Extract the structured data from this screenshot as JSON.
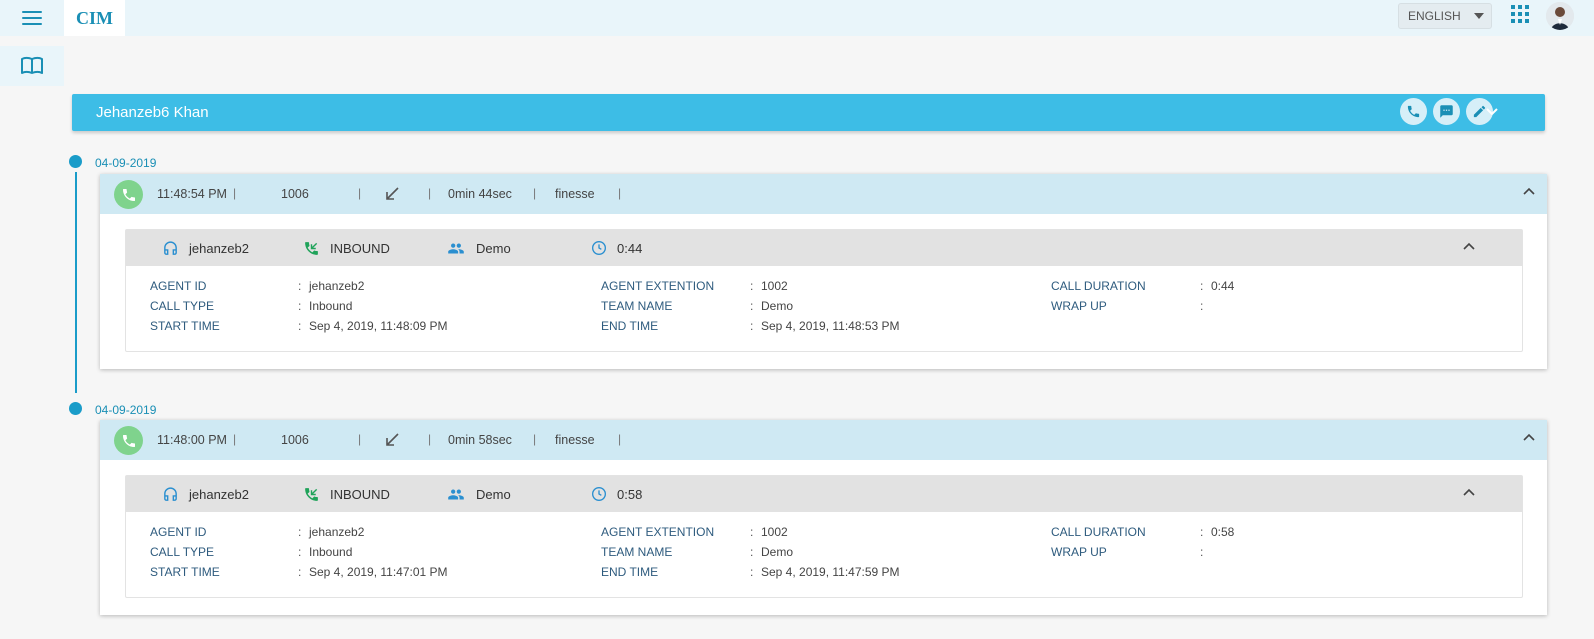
{
  "app": {
    "logo": "CIM"
  },
  "header": {
    "language": "ENGLISH"
  },
  "customer": {
    "name": "Jehanzeb6 Khan"
  },
  "calls": [
    {
      "date": "04-09-2019",
      "time": "11:48:54 PM",
      "number": "1006",
      "duration": "0min 44sec",
      "channel": "finesse",
      "agent": "jehanzeb2",
      "direction": "INBOUND",
      "team": "Demo",
      "timer": "0:44",
      "fields": {
        "agent_id_label": "AGENT ID",
        "agent_id": "jehanzeb2",
        "call_type_label": "CALL TYPE",
        "call_type": "Inbound",
        "start_time_label": "START TIME",
        "start_time": "Sep 4, 2019, 11:48:09 PM",
        "agent_ext_label": "AGENT EXTENTION",
        "agent_ext": "1002",
        "team_name_label": "TEAM NAME",
        "team_name": "Demo",
        "end_time_label": "END TIME",
        "end_time": "Sep 4, 2019, 11:48:53 PM",
        "call_duration_label": "CALL DURATION",
        "call_duration": "0:44",
        "wrap_up_label": "WRAP UP",
        "wrap_up": ""
      }
    },
    {
      "date": "04-09-2019",
      "time": "11:48:00 PM",
      "number": "1006",
      "duration": "0min 58sec",
      "channel": "finesse",
      "agent": "jehanzeb2",
      "direction": "INBOUND",
      "team": "Demo",
      "timer": "0:58",
      "fields": {
        "agent_id_label": "AGENT ID",
        "agent_id": "jehanzeb2",
        "call_type_label": "CALL TYPE",
        "call_type": "Inbound",
        "start_time_label": "START TIME",
        "start_time": "Sep 4, 2019, 11:47:01 PM",
        "agent_ext_label": "AGENT EXTENTION",
        "agent_ext": "1002",
        "team_name_label": "TEAM NAME",
        "team_name": "Demo",
        "end_time_label": "END TIME",
        "end_time": "Sep 4, 2019, 11:47:59 PM",
        "call_duration_label": "CALL DURATION",
        "call_duration": "0:58",
        "wrap_up_label": "WRAP UP",
        "wrap_up": ""
      }
    }
  ],
  "icons": {
    "menu": "hamburger-icon",
    "book": "book-icon",
    "apps": "apps-grid-icon",
    "call": "phone-icon",
    "chat": "chat-icon",
    "edit": "pencil-icon",
    "inbound": "arrow-down-left-icon",
    "agent": "headset-icon",
    "direction": "phone-in-icon",
    "team": "group-icon",
    "timer": "clock-icon"
  },
  "colors": {
    "accent": "#3dbde6",
    "brand": "#1a8fb5",
    "call_green": "#7fd38d",
    "head_bg": "#cfe9f3"
  }
}
